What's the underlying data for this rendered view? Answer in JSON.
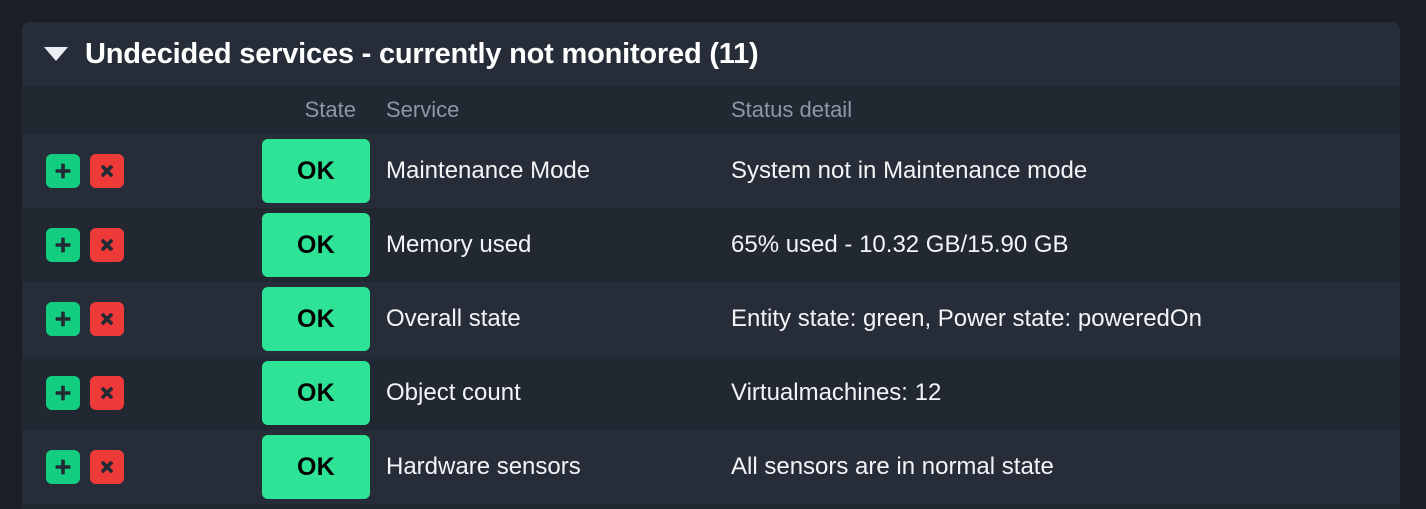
{
  "section": {
    "title": "Undecided services - currently not monitored (11)",
    "toggle_icon": "caret-down-icon",
    "expanded": true,
    "count": 11
  },
  "columns": {
    "actions": "",
    "state": "State",
    "service": "Service",
    "status_detail": "Status detail"
  },
  "row_actions": {
    "add_label": "+",
    "add_icon": "plus-icon",
    "remove_label": "×",
    "remove_icon": "cross-icon"
  },
  "colors": {
    "page_background": "#1b2028",
    "panel_background": "#212832",
    "header_background": "#272d38",
    "row_odd": "#272d38",
    "row_even": "#212832",
    "state_ok": "#2fe396",
    "action_add": "#13ce81",
    "action_remove": "#ee3b39",
    "text_primary": "#f2f4f7",
    "text_muted": "#8d97a6"
  },
  "rows": [
    {
      "state": "OK",
      "service": "Maintenance Mode",
      "status_detail": "System not in Maintenance mode"
    },
    {
      "state": "OK",
      "service": "Memory used",
      "status_detail": "65% used - 10.32 GB/15.90 GB"
    },
    {
      "state": "OK",
      "service": "Overall state",
      "status_detail": "Entity state: green, Power state: poweredOn"
    },
    {
      "state": "OK",
      "service": "Object count",
      "status_detail": "Virtualmachines: 12"
    },
    {
      "state": "OK",
      "service": "Hardware sensors",
      "status_detail": "All sensors are in normal state"
    }
  ]
}
